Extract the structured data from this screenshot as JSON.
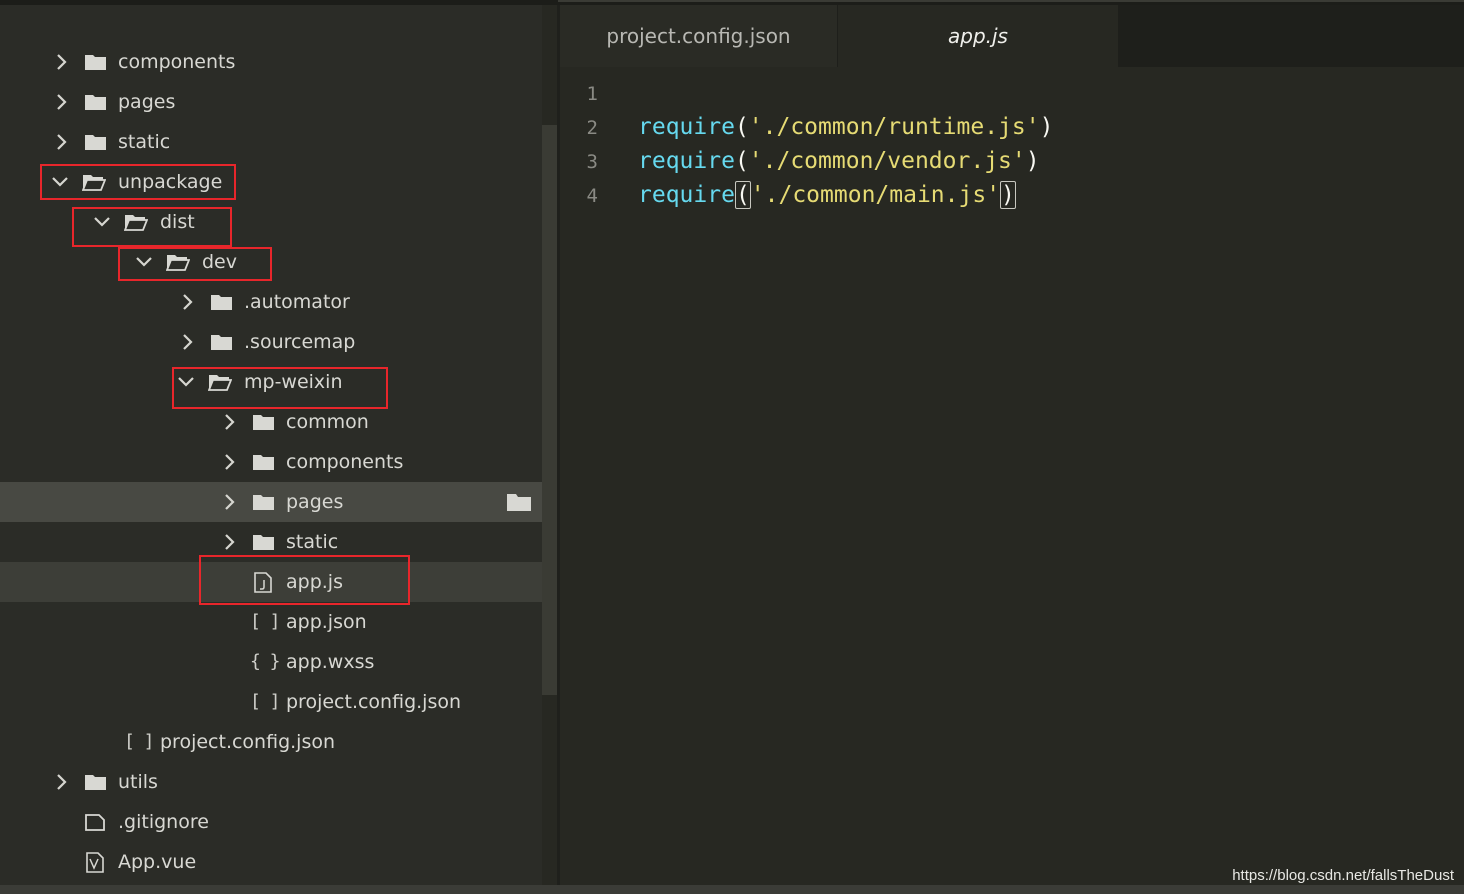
{
  "tree": {
    "items": [
      {
        "label": "components",
        "type": "folder",
        "state": "collapsed"
      },
      {
        "label": "pages",
        "type": "folder",
        "state": "collapsed"
      },
      {
        "label": "static",
        "type": "folder",
        "state": "collapsed"
      },
      {
        "label": "unpackage",
        "type": "folder",
        "state": "expanded"
      },
      {
        "label": "dist",
        "type": "folder",
        "state": "expanded"
      },
      {
        "label": "dev",
        "type": "folder",
        "state": "expanded"
      },
      {
        "label": ".automator",
        "type": "folder",
        "state": "collapsed"
      },
      {
        "label": ".sourcemap",
        "type": "folder",
        "state": "collapsed"
      },
      {
        "label": "mp-weixin",
        "type": "folder",
        "state": "expanded"
      },
      {
        "label": "common",
        "type": "folder",
        "state": "collapsed"
      },
      {
        "label": "components",
        "type": "folder",
        "state": "collapsed"
      },
      {
        "label": "pages",
        "type": "folder",
        "state": "collapsed"
      },
      {
        "label": "static",
        "type": "folder",
        "state": "collapsed"
      },
      {
        "label": "app.js",
        "type": "js-file"
      },
      {
        "label": "app.json",
        "type": "json-file",
        "icon_text": "[ ]"
      },
      {
        "label": "app.wxss",
        "type": "css-file",
        "icon_text": "{ }"
      },
      {
        "label": "project.config.json",
        "type": "json-file",
        "icon_text": "[ ]"
      },
      {
        "label": "project.config.json",
        "type": "json-file",
        "icon_text": "[ ]"
      },
      {
        "label": "utils",
        "type": "folder",
        "state": "collapsed"
      },
      {
        "label": ".gitignore",
        "type": "file"
      },
      {
        "label": "App.vue",
        "type": "vue-file"
      }
    ]
  },
  "tabs": [
    {
      "label": "project.config.json",
      "active": false
    },
    {
      "label": "app.js",
      "active": true
    }
  ],
  "editor": {
    "line_numbers": [
      "1",
      "2",
      "3",
      "4"
    ],
    "lines": [
      {
        "fn": "",
        "open": "",
        "str": "",
        "close": ""
      },
      {
        "fn": "require",
        "open": "(",
        "str": "'./common/runtime.js'",
        "close": ")"
      },
      {
        "fn": "require",
        "open": "(",
        "str": "'./common/vendor.js'",
        "close": ")"
      },
      {
        "fn": "require",
        "open": "(",
        "str": "'./common/main.js'",
        "close": ")"
      }
    ]
  },
  "watermark": "https://blog.csdn.net/fallsTheDust",
  "colors": {
    "highlight_box": "#e8262b",
    "function": "#66d9ef",
    "string": "#e6db74"
  }
}
